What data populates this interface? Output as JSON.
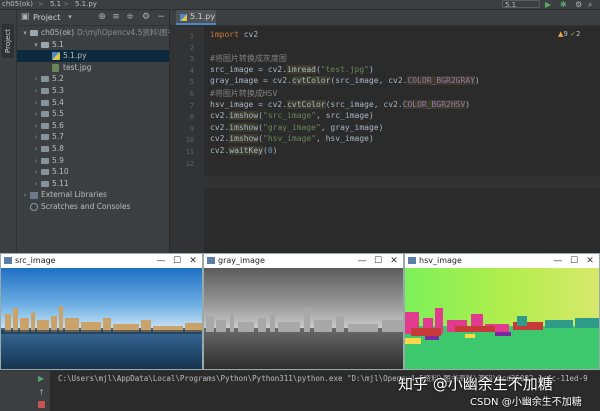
{
  "navbar": {
    "project": "ch05(ok)",
    "folder": "5.1",
    "file": "5.1.py",
    "run_config": "5.1",
    "separator": ">"
  },
  "left_stripe": {
    "project_tab": "Project"
  },
  "project_panel": {
    "title": "Project",
    "tree": [
      {
        "label": "ch05(ok)",
        "path": "D:\\mjl\\Opencv4.5资料\\图书资",
        "kind": "folder",
        "expanded": true,
        "depth": 0
      },
      {
        "label": "5.1",
        "kind": "folder",
        "expanded": true,
        "depth": 1
      },
      {
        "label": "5.1.py",
        "kind": "py",
        "depth": 2,
        "selected": true
      },
      {
        "label": "test.jpg",
        "kind": "img",
        "depth": 2
      },
      {
        "label": "5.2",
        "kind": "folder",
        "depth": 1
      },
      {
        "label": "5.3",
        "kind": "folder",
        "depth": 1
      },
      {
        "label": "5.4",
        "kind": "folder",
        "depth": 1
      },
      {
        "label": "5.5",
        "kind": "folder",
        "depth": 1
      },
      {
        "label": "5.6",
        "kind": "folder",
        "depth": 1
      },
      {
        "label": "5.7",
        "kind": "folder",
        "depth": 1
      },
      {
        "label": "5.8",
        "kind": "folder",
        "depth": 1
      },
      {
        "label": "5.9",
        "kind": "folder",
        "depth": 1
      },
      {
        "label": "5.10",
        "kind": "folder",
        "depth": 1
      },
      {
        "label": "5.11",
        "kind": "folder",
        "depth": 1
      },
      {
        "label": "External Libraries",
        "kind": "lib",
        "depth": 0
      },
      {
        "label": "Scratches and Consoles",
        "kind": "scratch",
        "depth": 0
      }
    ]
  },
  "editor": {
    "tab_label": "5.1.py",
    "warnings": "9",
    "checks": "2",
    "line_numbers": [
      "1",
      "2",
      "3",
      "4",
      "5",
      "6",
      "7",
      "8",
      "9",
      "10",
      "11",
      "12"
    ],
    "lines": [
      [
        {
          "t": "import",
          "c": "kw"
        },
        {
          "t": " cv2",
          "c": ""
        }
      ],
      [],
      [
        {
          "t": "#将图片转换成灰度图",
          "c": "cmt"
        }
      ],
      [
        {
          "t": "src_image = cv2.",
          "c": ""
        },
        {
          "t": "imread",
          "c": "fn"
        },
        {
          "t": "(",
          "c": ""
        },
        {
          "t": "\"test.jpg\"",
          "c": "str"
        },
        {
          "t": ")",
          "c": ""
        }
      ],
      [
        {
          "t": "gray_image = cv2.",
          "c": ""
        },
        {
          "t": "cvtColor",
          "c": "fn"
        },
        {
          "t": "(src_image, cv2.",
          "c": ""
        },
        {
          "t": "COLOR_BGR2GRAY",
          "c": "const"
        },
        {
          "t": ")",
          "c": ""
        }
      ],
      [
        {
          "t": "#将图片转换成HSV",
          "c": "cmt"
        }
      ],
      [
        {
          "t": "hsv_image = cv2.",
          "c": ""
        },
        {
          "t": "cvtColor",
          "c": "fn"
        },
        {
          "t": "(src_image, cv2.",
          "c": ""
        },
        {
          "t": "COLOR_BGR2HSV",
          "c": "const"
        },
        {
          "t": ")",
          "c": ""
        }
      ],
      [
        {
          "t": "cv2.",
          "c": ""
        },
        {
          "t": "imshow",
          "c": "fn"
        },
        {
          "t": "(",
          "c": ""
        },
        {
          "t": "\"src_image\"",
          "c": "str"
        },
        {
          "t": ", src_image)",
          "c": ""
        }
      ],
      [
        {
          "t": "cv2.",
          "c": ""
        },
        {
          "t": "imshow",
          "c": "fn"
        },
        {
          "t": "(",
          "c": ""
        },
        {
          "t": "\"gray_image\"",
          "c": "str"
        },
        {
          "t": ", gray_image)",
          "c": ""
        }
      ],
      [
        {
          "t": "cv2.",
          "c": ""
        },
        {
          "t": "imshow",
          "c": "fn"
        },
        {
          "t": "(",
          "c": ""
        },
        {
          "t": "\"hsv_image\"",
          "c": "str"
        },
        {
          "t": ", hsv_image)",
          "c": ""
        }
      ],
      [
        {
          "t": "cv2.",
          "c": ""
        },
        {
          "t": "waitKey",
          "c": "fn"
        },
        {
          "t": "(",
          "c": ""
        },
        {
          "t": "0",
          "c": "num"
        },
        {
          "t": ")",
          "c": ""
        }
      ],
      []
    ]
  },
  "windows": [
    {
      "title": "src_image",
      "kind": "src"
    },
    {
      "title": "gray_image",
      "kind": "gray"
    },
    {
      "title": "hsv_image",
      "kind": "hsv"
    }
  ],
  "console": {
    "command": "C:\\Users\\mjl\\AppData\\Local\\Programs\\Python\\Python311\\python.exe \"D:\\mjl\\Opencv4.5资料\\图书资料\\源码\\0cd25082-1cfc-11ed-9"
  },
  "watermark": {
    "zhihu": "知乎 @小幽余生不加糖",
    "csdn": "CSDN @小幽余生不加糖"
  },
  "colors": {
    "accent": "#4a88c7",
    "ide_bg": "#2b2b2b",
    "panel_bg": "#3c3f41",
    "selection": "#0d293e"
  }
}
